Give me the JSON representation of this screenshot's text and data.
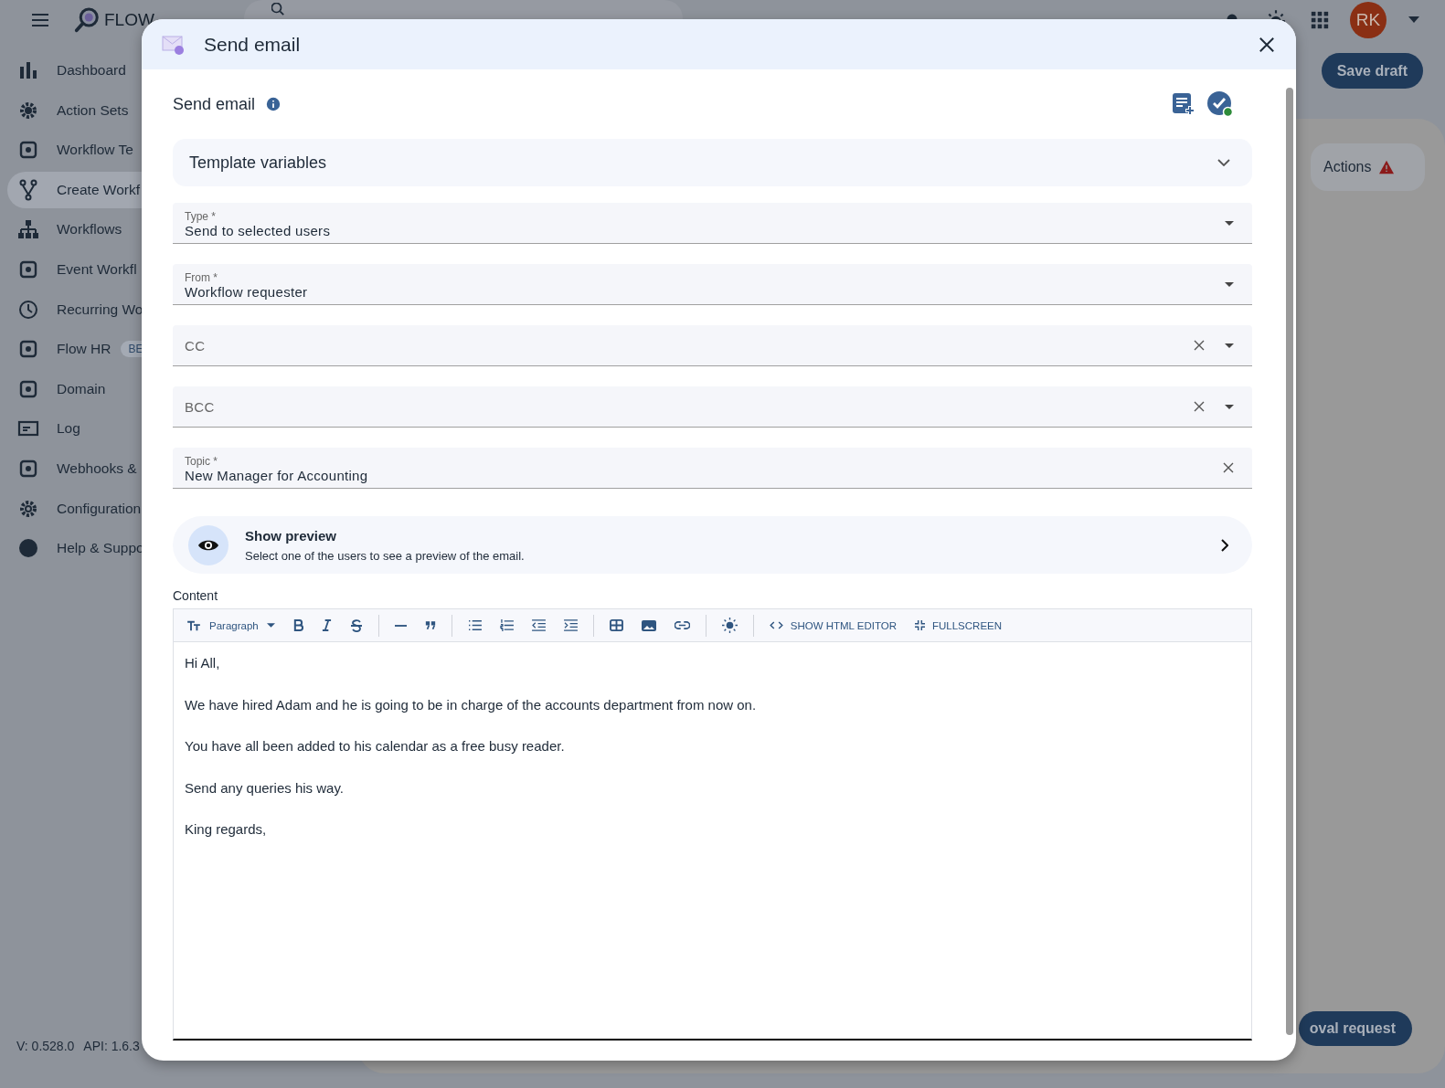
{
  "app": {
    "logo": "FLOW",
    "avatar": "RK",
    "save_button": "Save draft",
    "actions_tab": "Actions",
    "bottom_button": "oval request",
    "version": "V: 0.528.0",
    "api": "API: 1.6.3"
  },
  "sidebar": {
    "items": [
      {
        "label": "Dashboard",
        "selected": false
      },
      {
        "label": "Action Sets",
        "selected": false
      },
      {
        "label": "Workflow Te",
        "selected": false
      },
      {
        "label": "Create Workf",
        "selected": true
      },
      {
        "label": "Workflows",
        "selected": false
      },
      {
        "label": "Event Workfl",
        "selected": false
      },
      {
        "label": "Recurring Wo",
        "selected": false
      },
      {
        "label": "Flow HR",
        "badge": "BE",
        "selected": false
      },
      {
        "label": "Domain",
        "selected": false
      },
      {
        "label": "Log",
        "selected": false
      },
      {
        "label": "Webhooks &",
        "selected": false
      },
      {
        "label": "Configuration",
        "selected": false
      },
      {
        "label": "Help & Suppo",
        "selected": false
      }
    ]
  },
  "dialog": {
    "title": "Send email",
    "section_title": "Send email",
    "accordion": {
      "label": "Template variables",
      "expanded": false
    },
    "fields": [
      {
        "kind": "select",
        "label": "Type *",
        "value": "Send to selected users",
        "clearable": false
      },
      {
        "kind": "select",
        "label": "From *",
        "value": "Workflow requester",
        "clearable": false
      },
      {
        "kind": "select",
        "placeholder": "CC",
        "clearable": true
      },
      {
        "kind": "select",
        "placeholder": "BCC",
        "clearable": true
      },
      {
        "kind": "text",
        "label": "Topic *",
        "value": "New Manager for Accounting",
        "clearable": true
      }
    ],
    "preview": {
      "title": "Show preview",
      "subtitle": "Select one of the users to see a preview of the email."
    },
    "content_label": "Content",
    "toolbar": {
      "block_type": "Paragraph",
      "html_button": "SHOW HTML EDITOR",
      "fullscreen_button": "FULLSCREEN"
    },
    "body": [
      "Hi All,",
      "We have hired Adam and he is going to be in charge of the accounts department from now on.",
      "You have all been added to his calendar as a free busy reader.",
      "Send any queries his way.",
      "King regards,"
    ]
  }
}
